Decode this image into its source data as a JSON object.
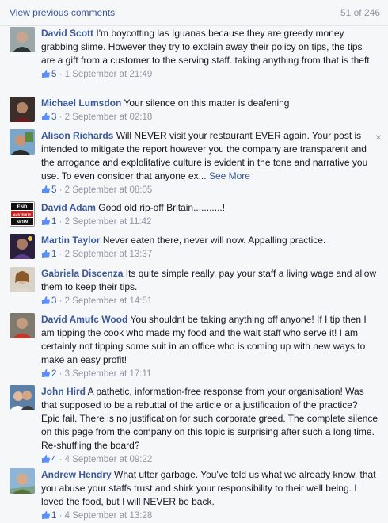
{
  "header": {
    "view_previous": "View previous comments",
    "count": "51 of 246"
  },
  "comments": [
    {
      "name": "David Scott",
      "text": "I'm boycotting las Iguanas because they are greedy money grabbing slime. However they try to explain away their policy on tips, the tips are a gift from a customer to the serving staff. taking anything from that is theft.",
      "likes": "5",
      "date": " · 1 September at 21:49"
    },
    {
      "name": "Michael Lumsdon",
      "text": "Your silence on this matter is deafening",
      "likes": "3",
      "date": " · 2 September at 02:18"
    },
    {
      "name": "Alison Richards",
      "text": "Will NEVER visit your restaurant EVER again. Your post is intended to mitigate the report however you the company are transparent and the arrogance and explolitative culture is evident in the tone and narrative you use. To even consider that anyone ex...",
      "see_more": "See More",
      "likes": "5",
      "date": " · 2 September at 08:05"
    },
    {
      "name": "David Adam",
      "text": "Good old rip-off Britain...........!",
      "likes": "1",
      "date": " · 2 September at 11:42"
    },
    {
      "name": "Martin Taylor",
      "text": "Never eaten there, never will now. Appalling practice.",
      "likes": "1",
      "date": " · 2 September at 13:37"
    },
    {
      "name": "Gabriela Discenza",
      "text": "Its quite simple really, pay your staff a living wage and allow them to keep their tips.",
      "likes": "3",
      "date": " · 2 September at 14:51"
    },
    {
      "name": "David Amufc Wood",
      "text": "You shouldnt be taking anything off anyone! If I tip then I am tipping the cook who made my food and the wait staff who serve it! I am certainly not tipping some suit in an office who is coming up with new ways to make an easy profit!",
      "likes": "2",
      "date": " · 3 September at 17:11"
    },
    {
      "name": "John Hird",
      "text": "A pathetic, information-free response from your organisation! Was that supposed to be a rebuttal of the article or a justification of the practice? Epic fail. There is no justification for such corporate greed. The complete silence on this page from the company on this topic is surprising after such a long time. Re-shuffling the board?",
      "likes": "4",
      "date": " · 4 September at 09:22"
    },
    {
      "name": "Andrew Hendry",
      "text": "What utter garbage. You've told us what we already know, that you abuse your staffs trust and shirk your responsibility to their well being. I loved the food, but I will NEVER be back.",
      "likes": "1",
      "date": " · 4 September at 13:28"
    }
  ],
  "close_glyph": "×",
  "avatar_badge": [
    "END",
    "AUSTERITY",
    "NOW"
  ],
  "colors": {
    "link": "#3b5998",
    "meta": "#9197a3",
    "background": "#f6f7f9"
  },
  "icons": {
    "like": "thumbs-up-icon",
    "close": "close-icon"
  }
}
